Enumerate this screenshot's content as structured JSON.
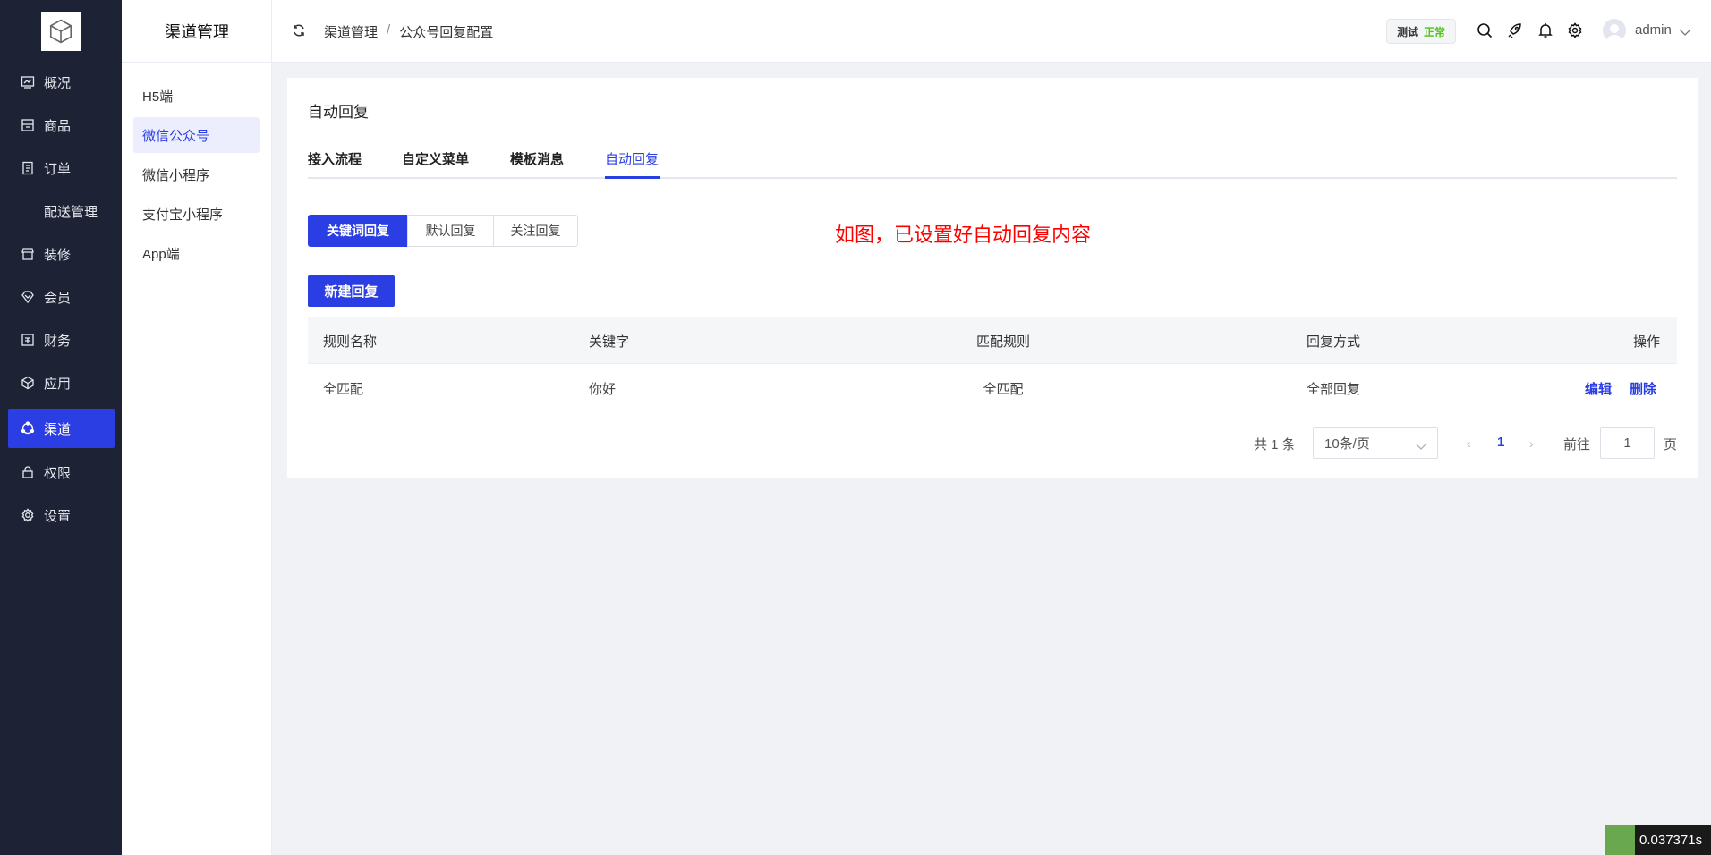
{
  "sidebar": {
    "items": [
      {
        "label": "概况",
        "icon": "chart-icon"
      },
      {
        "label": "商品",
        "icon": "box-icon"
      },
      {
        "label": "订单",
        "icon": "document-icon"
      },
      {
        "label": "配送管理",
        "icon": ""
      },
      {
        "label": "装修",
        "icon": "store-icon"
      },
      {
        "label": "会员",
        "icon": "diamond-icon"
      },
      {
        "label": "财务",
        "icon": "finance-icon"
      },
      {
        "label": "应用",
        "icon": "cube-icon"
      },
      {
        "label": "渠道",
        "icon": "channel-icon",
        "active": true
      },
      {
        "label": "权限",
        "icon": "lock-icon"
      },
      {
        "label": "设置",
        "icon": "gear-icon"
      }
    ]
  },
  "subnav": {
    "title": "渠道管理",
    "items": [
      "H5端",
      "微信公众号",
      "微信小程序",
      "支付宝小程序",
      "App端"
    ],
    "active": 1
  },
  "header": {
    "breadcrumb": [
      "渠道管理",
      "公众号回复配置"
    ],
    "separator": "/",
    "env_label": "测试",
    "env_status": "正常",
    "user": "admin"
  },
  "main": {
    "title": "自动回复",
    "tabs": [
      "接入流程",
      "自定义菜单",
      "模板消息",
      "自动回复"
    ],
    "active_tab": 3,
    "segments": [
      "关键词回复",
      "默认回复",
      "关注回复"
    ],
    "annotation": "如图，已设置好自动回复内容",
    "new_button": "新建回复",
    "table": {
      "headers": [
        "规则名称",
        "关键字",
        "匹配规则",
        "回复方式",
        "操作"
      ],
      "rows": [
        {
          "name": "全匹配",
          "keyword": "你好",
          "match": "全匹配",
          "reply": "全部回复",
          "actions": [
            "编辑",
            "删除"
          ]
        }
      ]
    },
    "pagination": {
      "total": "共 1 条",
      "page_size": "10条/页",
      "current": "1",
      "goto_label": "前往",
      "goto_value": "1",
      "page_suffix": "页"
    }
  },
  "timer": "0.037371s",
  "colors": {
    "primary": "#2b3ee3",
    "sidebar": "#1d2235",
    "annotation": "#ff0000",
    "status_ok": "#52c41a"
  }
}
